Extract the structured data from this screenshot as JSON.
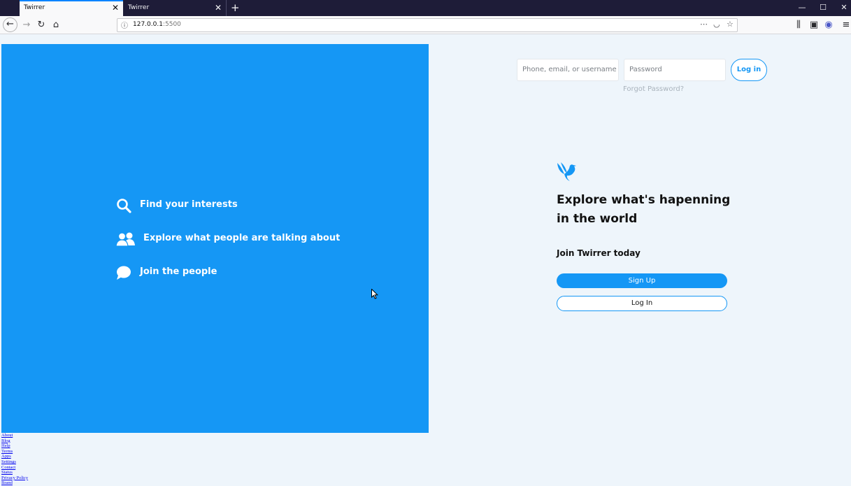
{
  "browser": {
    "tabs": [
      {
        "title": "Twirrer",
        "active": true
      },
      {
        "title": "Twirrer",
        "active": false
      }
    ],
    "url_host": "127.0.0.1",
    "url_port": ":5500"
  },
  "colors": {
    "brand_blue": "#1597f5",
    "page_bg": "#eef5fb"
  },
  "features": [
    {
      "icon": "search-icon",
      "label": "Find your interests"
    },
    {
      "icon": "people-icon",
      "label": "Explore what people are talking about"
    },
    {
      "icon": "speech-bubble-icon",
      "label": "Join the people"
    }
  ],
  "login": {
    "username_placeholder": "Phone, email, or username",
    "password_placeholder": "Password",
    "button": "Log in",
    "forgot": "Forgot Password?"
  },
  "main": {
    "headline_line1": "Explore what's hapenning",
    "headline_line2": "in the world",
    "join": "Join Twirrer today",
    "signup_button": "Sign Up",
    "login_button": "Log In"
  },
  "footer_links": [
    "About",
    "Blog",
    "Help",
    "Terms",
    "Apps",
    "Settings",
    "Contact",
    "Status",
    "Privacy Policy",
    "Brand"
  ]
}
